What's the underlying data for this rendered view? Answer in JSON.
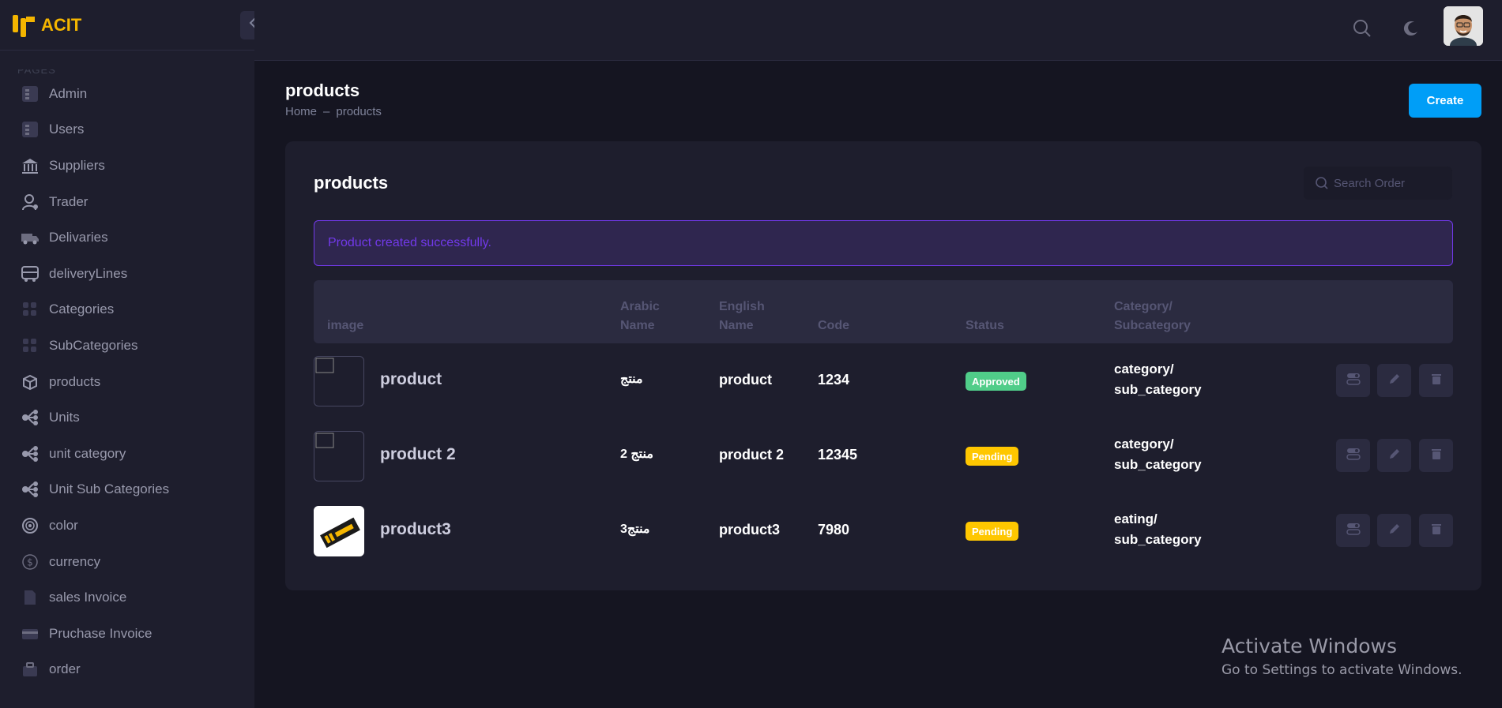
{
  "brand": {
    "name": "ACIT"
  },
  "sidebar": {
    "section_label": "PAGES",
    "items": [
      {
        "label": "Admin",
        "icon": "admin-icon"
      },
      {
        "label": "Users",
        "icon": "users-icon"
      },
      {
        "label": "Suppliers",
        "icon": "bank-icon"
      },
      {
        "label": "Trader",
        "icon": "user-gear-icon"
      },
      {
        "label": "Delivaries",
        "icon": "truck-icon"
      },
      {
        "label": "deliveryLines",
        "icon": "bus-icon"
      },
      {
        "label": "Categories",
        "icon": "grid-icon"
      },
      {
        "label": "SubCategories",
        "icon": "grid-icon"
      },
      {
        "label": "products",
        "icon": "box-icon"
      },
      {
        "label": "Units",
        "icon": "hierarchy-icon"
      },
      {
        "label": "unit category",
        "icon": "hierarchy-icon"
      },
      {
        "label": "Unit Sub Categories",
        "icon": "hierarchy-icon"
      },
      {
        "label": "color",
        "icon": "palette-icon"
      },
      {
        "label": "currency",
        "icon": "dollar-icon"
      },
      {
        "label": "sales Invoice",
        "icon": "document-icon"
      },
      {
        "label": "Pruchase Invoice",
        "icon": "credit-card-icon"
      },
      {
        "label": "order",
        "icon": "briefcase-icon"
      }
    ]
  },
  "header": {
    "search_icon": "search-icon",
    "theme_icon": "moon-icon"
  },
  "toolbar": {
    "title": "products",
    "breadcrumb": [
      "Home",
      "products"
    ],
    "create_label": "Create"
  },
  "card": {
    "title": "products",
    "search_placeholder": "Search Order",
    "alert": "Product created successfully."
  },
  "table": {
    "headers": {
      "image": "image",
      "arabic_1": "Arabic",
      "arabic_2": "Name",
      "english_1": "English",
      "english_2": "Name",
      "code": "Code",
      "status": "Status",
      "category_1": "Category/",
      "category_2": "Subcategory"
    },
    "rows": [
      {
        "name": "product",
        "arabic": "منتج",
        "english": "product",
        "code": "1234",
        "status": "Approved",
        "category_1": "category/",
        "category_2": "sub_category"
      },
      {
        "name": "product 2",
        "arabic": "منتج 2",
        "english": "product 2",
        "code": "12345",
        "status": "Pending",
        "category_1": "category/",
        "category_2": "sub_category"
      },
      {
        "name": "product3",
        "arabic": "منتج3",
        "english": "product3",
        "code": "7980",
        "status": "Pending",
        "category_1": "eating/",
        "category_2": "sub_category"
      }
    ]
  },
  "watermark": {
    "line1": "Activate Windows",
    "line2": "Go to Settings to activate Windows."
  },
  "colors": {
    "primary": "#009ef7",
    "approved": "#50cd89",
    "pending": "#ffc700",
    "alert": "#7239ea",
    "brand": "#f4b500"
  }
}
